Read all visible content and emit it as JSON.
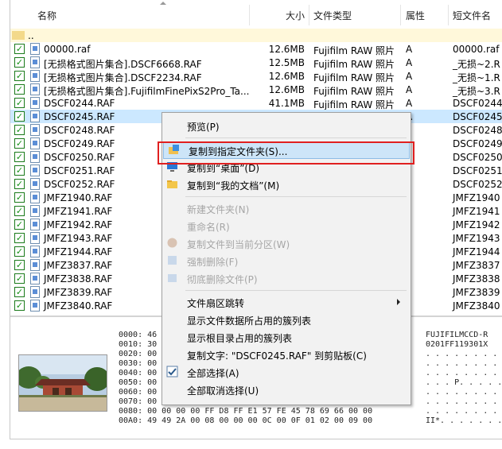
{
  "columns": {
    "name": "名称",
    "size": "大小",
    "type": "文件类型",
    "attr": "属性",
    "short": "短文件名"
  },
  "parent_label": "..",
  "files": [
    {
      "name": "00000.raf",
      "size": "12.6MB",
      "type": "Fujifilm RAW 照片",
      "attr": "A",
      "short": "00000.raf",
      "selected": false
    },
    {
      "name": "[无损格式图片集合].DSCF6668.RAF",
      "size": "12.5MB",
      "type": "Fujifilm RAW 照片",
      "attr": "A",
      "short": "_无损~2.R",
      "selected": false
    },
    {
      "name": "[无损格式图片集合].DSCF2234.RAF",
      "size": "12.6MB",
      "type": "Fujifilm RAW 照片",
      "attr": "A",
      "short": "_无损~1.R",
      "selected": false
    },
    {
      "name": "[无损格式图片集合].FujifilmFinePixS2Pro_Ta...",
      "size": "12.6MB",
      "type": "Fujifilm RAW 照片",
      "attr": "A",
      "short": "_无损~3.R",
      "selected": false
    },
    {
      "name": "DSCF0244.RAF",
      "size": "41.1MB",
      "type": "Fujifilm RAW 照片",
      "attr": "A",
      "short": "DSCF0244",
      "selected": false
    },
    {
      "name": "DSCF0245.RAF",
      "size": "41.2MB",
      "type": "Fujifilm RAW 照片",
      "attr": "A",
      "short": "DSCF0245",
      "selected": true
    },
    {
      "name": "DSCF0248.RAF",
      "size": "",
      "type": "",
      "attr": "",
      "short": "DSCF0248",
      "selected": false
    },
    {
      "name": "DSCF0249.RAF",
      "size": "",
      "type": "",
      "attr": "",
      "short": "DSCF0249",
      "selected": false
    },
    {
      "name": "DSCF0250.RAF",
      "size": "",
      "type": "",
      "attr": "",
      "short": "DSCF0250",
      "selected": false
    },
    {
      "name": "DSCF0251.RAF",
      "size": "",
      "type": "",
      "attr": "",
      "short": "DSCF0251",
      "selected": false
    },
    {
      "name": "DSCF0252.RAF",
      "size": "",
      "type": "",
      "attr": "",
      "short": "DSCF0252",
      "selected": false
    },
    {
      "name": "JMFZ1940.RAF",
      "size": "",
      "type": "",
      "attr": "",
      "short": "JMFZ1940",
      "selected": false
    },
    {
      "name": "JMFZ1941.RAF",
      "size": "",
      "type": "",
      "attr": "",
      "short": "JMFZ1941",
      "selected": false
    },
    {
      "name": "JMFZ1942.RAF",
      "size": "",
      "type": "",
      "attr": "",
      "short": "JMFZ1942",
      "selected": false
    },
    {
      "name": "JMFZ1943.RAF",
      "size": "",
      "type": "",
      "attr": "",
      "short": "JMFZ1943",
      "selected": false
    },
    {
      "name": "JMFZ1944.RAF",
      "size": "",
      "type": "",
      "attr": "",
      "short": "JMFZ1944",
      "selected": false
    },
    {
      "name": "JMFZ3837.RAF",
      "size": "",
      "type": "",
      "attr": "",
      "short": "JMFZ3837",
      "selected": false
    },
    {
      "name": "JMFZ3838.RAF",
      "size": "",
      "type": "",
      "attr": "",
      "short": "JMFZ3838",
      "selected": false
    },
    {
      "name": "JMFZ3839.RAF",
      "size": "",
      "type": "",
      "attr": "",
      "short": "JMFZ3839",
      "selected": false
    },
    {
      "name": "JMFZ3840.RAF",
      "size": "",
      "type": "",
      "attr": "",
      "short": "JMFZ3840",
      "selected": false
    }
  ],
  "hex": {
    "lines": [
      "0000: 46",
      "0010: 30",
      "0020: 00",
      "0030: 00",
      "0040: 00",
      "0050: 00",
      "0060: 00",
      "0070: 00",
      "0080: 00 00 00 00 FF D8 FF E1 57 FE 45 78 69 66 00 00",
      "00A0: 49 49 2A 00 08 00 00 00 0C 00 0F 01 02 00 09 00"
    ],
    "ascii": [
      "FUJIFILMCCD-R",
      "0201FF119301X",
      ". . . . . . . . . . . 0",
      ". . . . . . . . . . . .",
      ". . . . . . . . . . . .",
      ". . . P. . . . . . . . .",
      ". . . . . . . . . . . .",
      ". . . . . . . . . . . .",
      ". . . . . . . . . W. Exi",
      "II*. . . . . . . . . . ."
    ]
  },
  "menu": {
    "items": [
      {
        "label": "预览(P)",
        "icon": "",
        "disabled": false,
        "highlighted": false,
        "submenu": false
      },
      {
        "sep": true
      },
      {
        "label": "复制到指定文件夹(S)...",
        "icon": "copy-to-folder-icon",
        "disabled": false,
        "highlighted": true,
        "submenu": false
      },
      {
        "label": "复制到“桌面”(D)",
        "icon": "desktop-icon",
        "disabled": false,
        "highlighted": false,
        "submenu": false
      },
      {
        "label": "复制到“我的文档”(M)",
        "icon": "folder-icon",
        "disabled": false,
        "highlighted": false,
        "submenu": false
      },
      {
        "sep": true
      },
      {
        "label": "新建文件夹(N)",
        "icon": "",
        "disabled": true,
        "highlighted": false,
        "submenu": false
      },
      {
        "label": "重命名(R)",
        "icon": "",
        "disabled": true,
        "highlighted": false,
        "submenu": false
      },
      {
        "label": "复制文件到当前分区(W)",
        "icon": "copy-partition-icon",
        "disabled": true,
        "highlighted": false,
        "submenu": false
      },
      {
        "label": "强制删除(F)",
        "icon": "force-delete-icon",
        "disabled": true,
        "highlighted": false,
        "submenu": false
      },
      {
        "label": "彻底删除文件(P)",
        "icon": "wipe-icon",
        "disabled": true,
        "highlighted": false,
        "submenu": false
      },
      {
        "sep": true
      },
      {
        "label": "文件扇区跳转",
        "icon": "",
        "disabled": false,
        "highlighted": false,
        "submenu": true
      },
      {
        "label": "显示文件数据所占用的簇列表",
        "icon": "",
        "disabled": false,
        "highlighted": false,
        "submenu": false
      },
      {
        "label": "显示根目录占用的簇列表",
        "icon": "",
        "disabled": false,
        "highlighted": false,
        "submenu": false
      },
      {
        "label": "复制文字: \"DSCF0245.RAF\" 到剪贴板(C)",
        "icon": "",
        "disabled": false,
        "highlighted": false,
        "submenu": false
      },
      {
        "label": "全部选择(A)",
        "icon": "checkbox-icon",
        "disabled": false,
        "highlighted": false,
        "submenu": false
      },
      {
        "label": "全部取消选择(U)",
        "icon": "",
        "disabled": false,
        "highlighted": false,
        "submenu": false
      }
    ]
  },
  "colors": {
    "accent_check": "#159015",
    "highlight_border": "#e02020",
    "selected_row": "#cce8ff"
  }
}
